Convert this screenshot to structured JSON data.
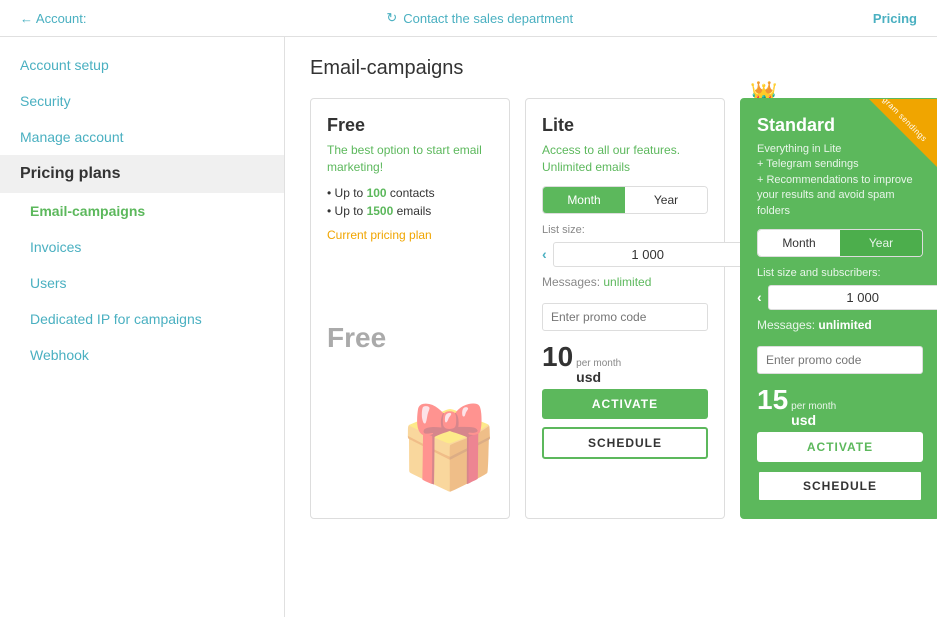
{
  "topbar": {
    "back_label": "← Account:",
    "contact_label": "Contact the sales department",
    "pricing_label": "Pricing"
  },
  "sidebar": {
    "items": [
      {
        "id": "account-setup",
        "label": "Account setup",
        "type": "link"
      },
      {
        "id": "security",
        "label": "Security",
        "type": "link"
      },
      {
        "id": "manage-account",
        "label": "Manage account",
        "type": "link"
      },
      {
        "id": "pricing-plans",
        "label": "Pricing plans",
        "type": "active-section"
      },
      {
        "id": "email-campaigns",
        "label": "Email-campaigns",
        "type": "active-sub"
      },
      {
        "id": "invoices",
        "label": "Invoices",
        "type": "sub"
      },
      {
        "id": "users",
        "label": "Users",
        "type": "sub"
      },
      {
        "id": "dedicated-ip",
        "label": "Dedicated IP for campaigns",
        "type": "sub"
      },
      {
        "id": "webhook",
        "label": "Webhook",
        "type": "sub"
      }
    ]
  },
  "main": {
    "page_title": "Email-campaigns",
    "plans": [
      {
        "id": "free",
        "name": "Free",
        "description": "The best option to start email marketing!",
        "features": [
          {
            "text": "Up to ",
            "highlight": "100",
            "rest": " contacts"
          },
          {
            "text": "Up to ",
            "highlight": "1500",
            "rest": " emails"
          }
        ],
        "current_plan_label": "Current pricing plan",
        "free_price_label": "Free",
        "is_free": true
      },
      {
        "id": "lite",
        "name": "Lite",
        "description": "Access to all our features. Unlimited emails",
        "billing_toggle": [
          "Month",
          "Year"
        ],
        "active_toggle": 0,
        "list_size_label": "List size:",
        "list_size_value": "1 000",
        "messages_label": "Messages:",
        "messages_value": "unlimited",
        "promo_placeholder": "Enter promo code",
        "price_big": "10",
        "price_per_month": "per month",
        "price_currency": "usd",
        "activate_label": "ACTIVATE",
        "schedule_label": "SCHEDULE"
      },
      {
        "id": "standard",
        "name": "Standard",
        "description": "Everything in Lite\n+ Telegram sendings\n+ Recommendations to improve your results and avoid spam folders",
        "telegram_badge": "Telegram sendings",
        "billing_toggle": [
          "Month",
          "Year"
        ],
        "active_toggle": 0,
        "list_size_label": "List size and subscribers:",
        "list_size_value": "1 000",
        "messages_label": "Messages:",
        "messages_value": "unlimited",
        "promo_placeholder": "Enter promo code",
        "price_big": "15",
        "price_per_month": "per month",
        "price_currency": "usd",
        "activate_label": "ACTIVATE",
        "schedule_label": "SCHEDULE",
        "is_standard": true
      }
    ]
  }
}
